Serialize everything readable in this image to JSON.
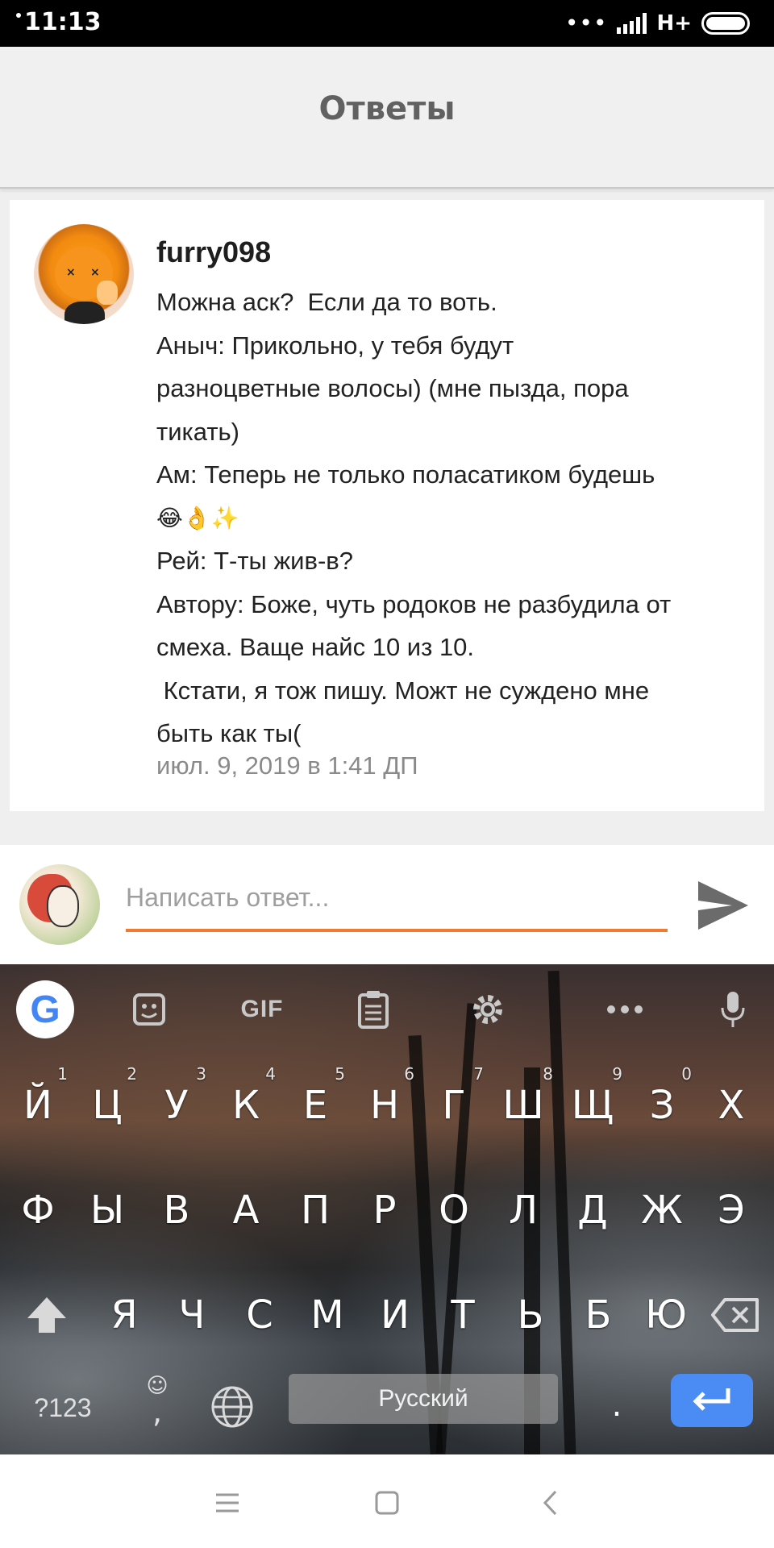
{
  "status_bar": {
    "time": "11:13",
    "dots": "•••",
    "network": "H+"
  },
  "app_bar": {
    "title": "Ответы"
  },
  "comment": {
    "username": "furry098",
    "lines": [
      "Можна аск?  Если да то воть.",
      "Аныч: Прикольно, у тебя будут",
      "разноцветные волосы) (мне пызда, пора",
      "тикать)",
      "Ам: Теперь не только поласатиком будешь",
      "😂👌✨",
      "Рей: Т-ты жив-в?",
      "Автору: Боже, чуть родоков не разбудила от",
      "смеха. Ваще найс 10 из 10.",
      " Кстати, я тож пишу. Можт не суждено мне",
      "быть как ты("
    ],
    "timestamp": "июл. 9, 2019 в 1:41 ДП"
  },
  "reply": {
    "placeholder": "Написать ответ...",
    "value": "",
    "accent_color": "#f07a30"
  },
  "keyboard": {
    "toolbar": {
      "google_icon": "G",
      "gif_label": "GIF",
      "icons": [
        "google-icon",
        "sticker-icon",
        "gif-icon",
        "clipboard-icon",
        "settings-icon",
        "more-icon",
        "mic-icon"
      ]
    },
    "row1": [
      {
        "label": "Й",
        "hint": "1"
      },
      {
        "label": "Ц",
        "hint": "2"
      },
      {
        "label": "У",
        "hint": "3"
      },
      {
        "label": "К",
        "hint": "4"
      },
      {
        "label": "Е",
        "hint": "5"
      },
      {
        "label": "Н",
        "hint": "6"
      },
      {
        "label": "Г",
        "hint": "7"
      },
      {
        "label": "Ш",
        "hint": "8"
      },
      {
        "label": "Щ",
        "hint": "9"
      },
      {
        "label": "З",
        "hint": "0"
      },
      {
        "label": "Х",
        "hint": ""
      }
    ],
    "row2": [
      {
        "label": "Ф"
      },
      {
        "label": "Ы"
      },
      {
        "label": "В"
      },
      {
        "label": "А"
      },
      {
        "label": "П"
      },
      {
        "label": "Р"
      },
      {
        "label": "О"
      },
      {
        "label": "Л"
      },
      {
        "label": "Д"
      },
      {
        "label": "Ж"
      },
      {
        "label": "Э"
      }
    ],
    "row3": [
      {
        "label": "Я"
      },
      {
        "label": "Ч"
      },
      {
        "label": "С"
      },
      {
        "label": "М"
      },
      {
        "label": "И"
      },
      {
        "label": "Т"
      },
      {
        "label": "Ь"
      },
      {
        "label": "Б"
      },
      {
        "label": "Ю"
      }
    ],
    "symbols_label": "?123",
    "emoji_glyph": "☺",
    "comma": ",",
    "space_label": "Русский",
    "period": ".",
    "enter_color": "#4a8cf4"
  },
  "nav_bar": {
    "icons": [
      "menu-icon",
      "home-icon",
      "back-icon"
    ]
  }
}
